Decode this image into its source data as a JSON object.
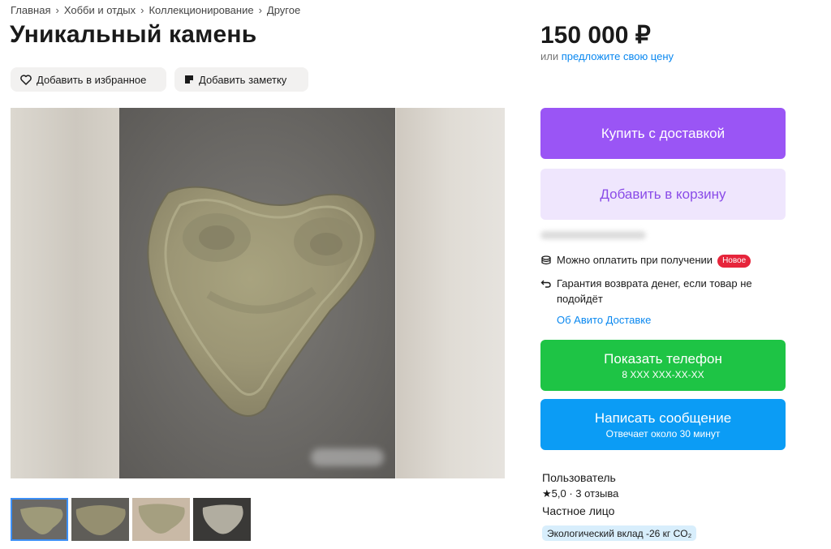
{
  "breadcrumb": [
    "Главная",
    "Хобби и отдых",
    "Коллекционирование",
    "Другое"
  ],
  "breadcrumb_separator": "›",
  "title": "Уникальный камень",
  "actions": {
    "favorite_label": "Добавить в избранное",
    "note_label": "Добавить заметку"
  },
  "price": "150 000 ₽",
  "offer": {
    "prefix": "или",
    "link": "предложите свою цену"
  },
  "buttons": {
    "buy": "Купить с доставкой",
    "cart": "Добавить в корзину",
    "phone": "Показать телефон",
    "phone_sub": "8 XXX XXX-XX-XX",
    "message": "Написать сообщение",
    "message_sub": "Отвечает около 30 минут"
  },
  "delivery": {
    "pay_on_receipt": "Можно оплатить при получении",
    "new_badge": "Новое",
    "guarantee": "Гарантия возврата денег, если товар не подойдёт",
    "about_link": "Об Авито Доставке"
  },
  "seller": {
    "name": "Пользователь",
    "rating": "5,0 · 3 отзыва",
    "type": "Частное лицо",
    "eco": "Экологический вклад -26 кг CO₂"
  },
  "icons": {
    "favorite": "heart-icon",
    "note": "note-icon",
    "wallet": "wallet-icon",
    "return": "return-arrow-icon",
    "star": "star-icon"
  },
  "colors": {
    "buy": "#9a55f5",
    "cart_bg": "#efe6fd",
    "phone": "#1ec445",
    "message": "#0b9cf5",
    "link": "#0a88f0",
    "badge": "#e6253b"
  },
  "gallery": {
    "thumbnail_count": 4,
    "active_index": 0
  }
}
